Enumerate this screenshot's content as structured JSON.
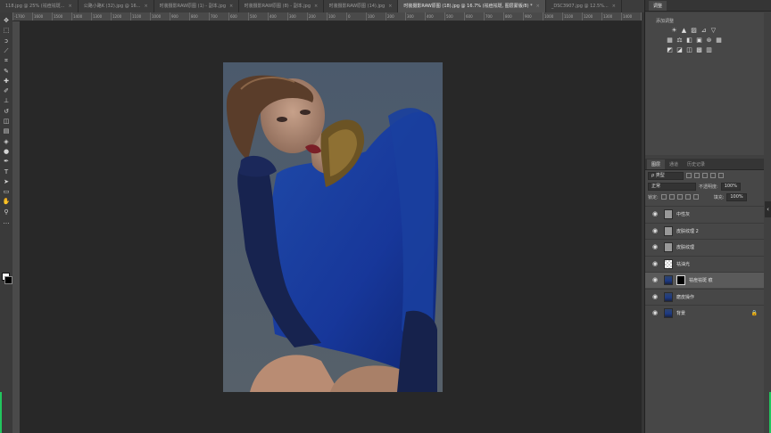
{
  "tabs": [
    {
      "label": "118.jpg @ 25% (祛痘祛斑...",
      "active": false
    },
    {
      "label": "公路小路K (32).jpg @ 16...",
      "active": false
    },
    {
      "label": "时装摄影RAW原图 (1) - 副本.jpg",
      "active": false
    },
    {
      "label": "时装摄影RAW原图 (8) - 副本.jpg",
      "active": false
    },
    {
      "label": "时装摄影RAW原图 (14).jpg",
      "active": false
    },
    {
      "label": "时装摄影RAW原图 (18).jpg @ 16.7% (祛痘祛斑, 图层蒙版/8) *",
      "active": true
    },
    {
      "label": "_DSC3907.jpg @ 12.5%...",
      "active": false
    }
  ],
  "tab_close": "×",
  "ruler_marks": [
    "-1700",
    "1600",
    "1500",
    "1400",
    "1300",
    "1200",
    "1100",
    "1000",
    "900",
    "800",
    "700",
    "600",
    "500",
    "400",
    "300",
    "200",
    "100",
    "0",
    "100",
    "200",
    "300",
    "400",
    "500",
    "600",
    "700",
    "800",
    "900",
    "1000",
    "1100",
    "1200",
    "1300",
    "1400",
    "1500",
    "1600"
  ],
  "tools": [
    {
      "name": "move-tool",
      "glyph": "✥"
    },
    {
      "name": "marquee-tool",
      "glyph": "⬚"
    },
    {
      "name": "lasso-tool",
      "glyph": "ↄ"
    },
    {
      "name": "quick-select-tool",
      "glyph": "⟋"
    },
    {
      "name": "crop-tool",
      "glyph": "⌗"
    },
    {
      "name": "eyedropper-tool",
      "glyph": "✎"
    },
    {
      "name": "healing-brush-tool",
      "glyph": "✚"
    },
    {
      "name": "brush-tool",
      "glyph": "✐"
    },
    {
      "name": "clone-stamp-tool",
      "glyph": "⊥"
    },
    {
      "name": "history-brush-tool",
      "glyph": "↺"
    },
    {
      "name": "eraser-tool",
      "glyph": "◫"
    },
    {
      "name": "gradient-tool",
      "glyph": "▤"
    },
    {
      "name": "blur-tool",
      "glyph": "◈"
    },
    {
      "name": "dodge-tool",
      "glyph": "●"
    },
    {
      "name": "pen-tool",
      "glyph": "✒"
    },
    {
      "name": "type-tool",
      "glyph": "T"
    },
    {
      "name": "path-select-tool",
      "glyph": "➤"
    },
    {
      "name": "shape-tool",
      "glyph": "▭"
    },
    {
      "name": "hand-tool",
      "glyph": "✋"
    },
    {
      "name": "zoom-tool",
      "glyph": "⚲"
    },
    {
      "name": "more-tools",
      "glyph": "…"
    }
  ],
  "adjustments": {
    "tab": "调整",
    "title": "添加调整",
    "row1": [
      "☀",
      "▲",
      "▨",
      "⊿",
      "▽"
    ],
    "row2": [
      "▦",
      "⚖",
      "◧",
      "▣",
      "⊛",
      "▦"
    ],
    "row3": [
      "◩",
      "◪",
      "◫",
      "▩",
      "▥"
    ]
  },
  "layers_panel": {
    "tabs": [
      "图层",
      "通道",
      "历史记录"
    ],
    "filter_kind": "ρ 类型",
    "blend_mode": "正常",
    "opacity_label": "不透明度:",
    "opacity_value": "100%",
    "lock_label": "锁定:",
    "fill_label": "填充:",
    "fill_value": "100%",
    "eye_glyph": "◉",
    "lock_glyph": "🔒",
    "layers": [
      {
        "name": "中性灰",
        "thumb": "gray",
        "mask": false,
        "selected": false,
        "locked": false
      },
      {
        "name": "皮肤纹理 2",
        "thumb": "gray",
        "mask": false,
        "selected": false,
        "locked": false
      },
      {
        "name": "皮肤纹理",
        "thumb": "gray",
        "mask": false,
        "selected": false,
        "locked": false
      },
      {
        "name": "祛油光",
        "thumb": "checker",
        "mask": false,
        "selected": false,
        "locked": false
      },
      {
        "name": "祛痘祛斑 痕",
        "thumb": "photo-th",
        "mask": true,
        "selected": true,
        "locked": false
      },
      {
        "name": "磨皮操作",
        "thumb": "photo-th",
        "mask": false,
        "selected": false,
        "locked": false
      },
      {
        "name": "背景",
        "thumb": "photo-th",
        "mask": false,
        "selected": false,
        "locked": true
      }
    ]
  },
  "collapse_arrow": "‹",
  "colors": {
    "accent": "#22c55e",
    "dress_blue": "#1d3f9a",
    "bg": "#282828"
  }
}
